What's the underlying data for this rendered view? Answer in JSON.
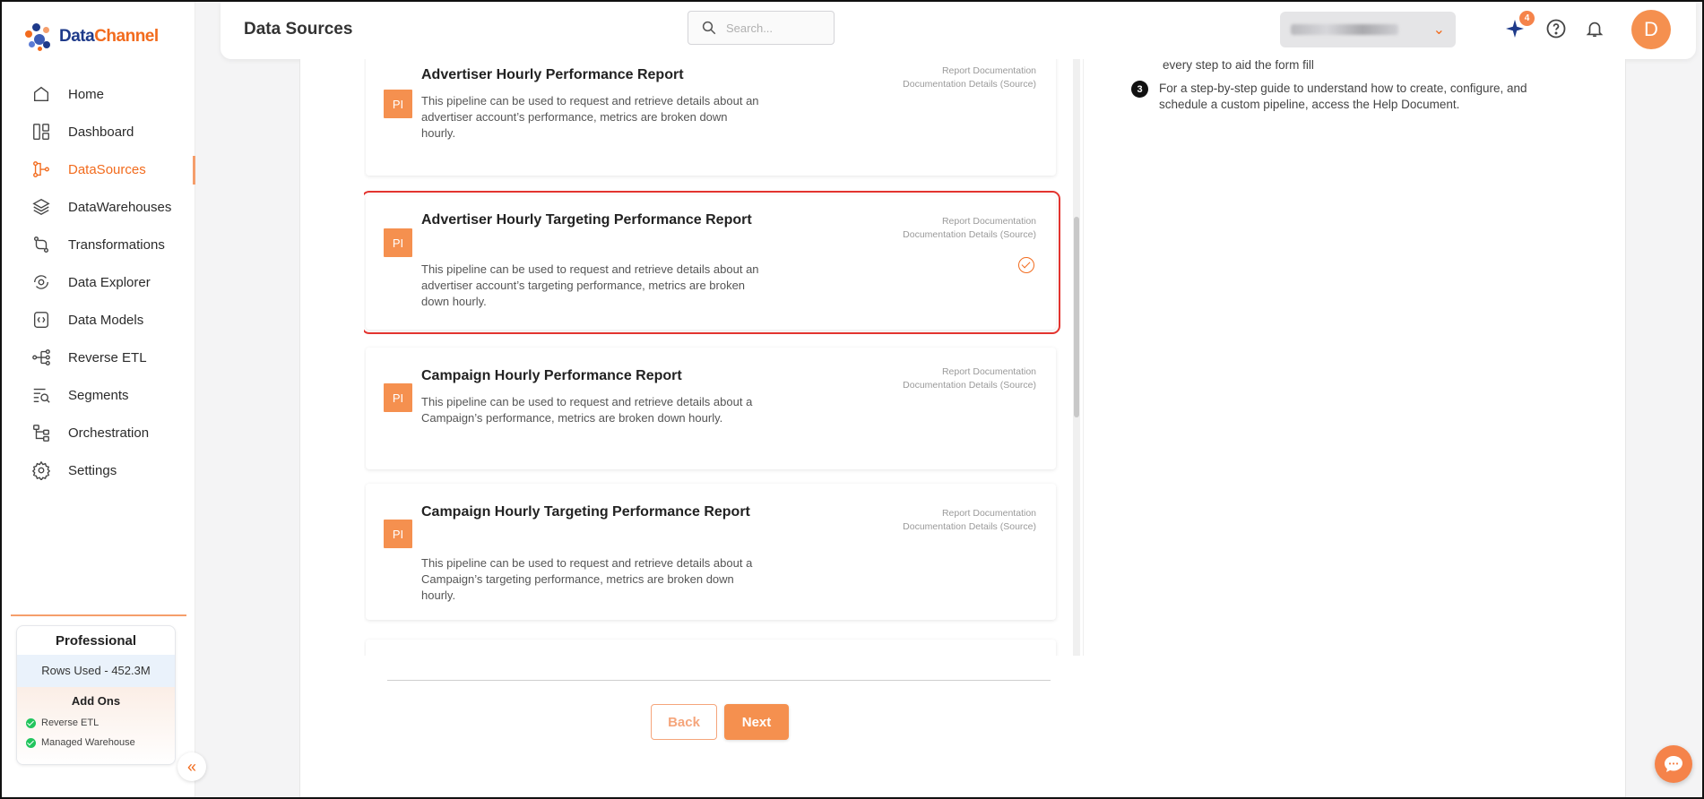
{
  "brand": {
    "name_part1": "Data",
    "name_part2": "Channel"
  },
  "header": {
    "title": "Data Sources",
    "search_placeholder": "Search...",
    "notification_count": "4",
    "avatar_letter": "D"
  },
  "sidebar": {
    "items": [
      {
        "label": "Home",
        "icon": "home-icon"
      },
      {
        "label": "Dashboard",
        "icon": "dashboard-icon"
      },
      {
        "label": "DataSources",
        "icon": "datasources-icon",
        "active": true
      },
      {
        "label": "DataWarehouses",
        "icon": "layers-icon"
      },
      {
        "label": "Transformations",
        "icon": "transform-icon"
      },
      {
        "label": "Data Explorer",
        "icon": "explorer-icon"
      },
      {
        "label": "Data Models",
        "icon": "models-icon"
      },
      {
        "label": "Reverse ETL",
        "icon": "reverse-etl-icon"
      },
      {
        "label": "Segments",
        "icon": "segments-icon"
      },
      {
        "label": "Orchestration",
        "icon": "orchestration-icon"
      },
      {
        "label": "Settings",
        "icon": "gear-icon"
      }
    ],
    "plan": {
      "name": "Professional",
      "rows_used": "Rows Used - 452.3M",
      "addons_title": "Add Ons",
      "addons": [
        "Reverse ETL",
        "Managed Warehouse"
      ]
    }
  },
  "reports": [
    {
      "icon_text": "PI",
      "title": "Advertiser Hourly Performance Report",
      "description": "This pipeline can be used to request and retrieve details about an advertiser account’s performance, metrics are broken down hourly.",
      "link1": "Report Documentation",
      "link2": "Documentation Details (Source)",
      "selected": false
    },
    {
      "icon_text": "PI",
      "title": "Advertiser Hourly Targeting Performance Report",
      "description": "This pipeline can be used to request and retrieve details about an advertiser account’s targeting performance, metrics are broken down hourly.",
      "link1": "Report Documentation",
      "link2": "Documentation Details (Source)",
      "selected": true
    },
    {
      "icon_text": "PI",
      "title": "Campaign Hourly Performance Report",
      "description": "This pipeline can be used to request and retrieve details about a Campaign’s performance, metrics are broken down hourly.",
      "link1": "Report Documentation",
      "link2": "Documentation Details (Source)",
      "selected": false
    },
    {
      "icon_text": "PI",
      "title": "Campaign Hourly Targeting Performance Report",
      "description": "This pipeline can be used to request and retrieve details about a Campaign’s targeting performance, metrics are broken down hourly.",
      "link1": "Report Documentation",
      "link2": "Documentation Details (Source)",
      "selected": false
    }
  ],
  "help": {
    "partial_line": "every step to aid the form fill",
    "step3_number": "3",
    "step3_text": "For a step-by-step guide to understand how to create, configure, and schedule a custom pipeline, access the Help Document."
  },
  "actions": {
    "back": "Back",
    "next": "Next"
  },
  "colors": {
    "accent": "#f26b1d",
    "accent_light": "#f5904f",
    "selection": "#e3342f"
  }
}
